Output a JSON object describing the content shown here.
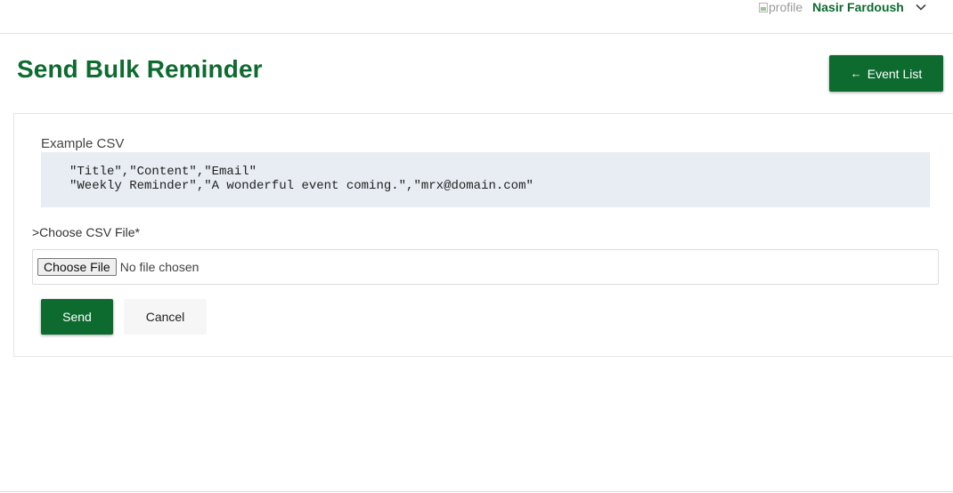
{
  "header": {
    "profile_image_alt": "profile",
    "user_name": "Nasir Fardoush",
    "dropdown_icon": "chevron-down-icon"
  },
  "page": {
    "title": "Send Bulk Reminder",
    "event_list_button": "Event List",
    "back_icon": "arrow-left-icon"
  },
  "form": {
    "example_label": "Example CSV",
    "example_lines": [
      "\"Title\",\"Content\",\"Email\"",
      "\"Weekly Reminder\",\"A wonderful event coming.\",\"mrx@domain.com\""
    ],
    "file_label": ">Choose CSV File*",
    "choose_file_button": "Choose File",
    "file_status": "No file chosen",
    "send_button": "Send",
    "cancel_button": "Cancel"
  },
  "colors": {
    "brand_green": "#0e6b30",
    "code_background": "#e7edf3",
    "cancel_background": "#f6f6f6"
  }
}
